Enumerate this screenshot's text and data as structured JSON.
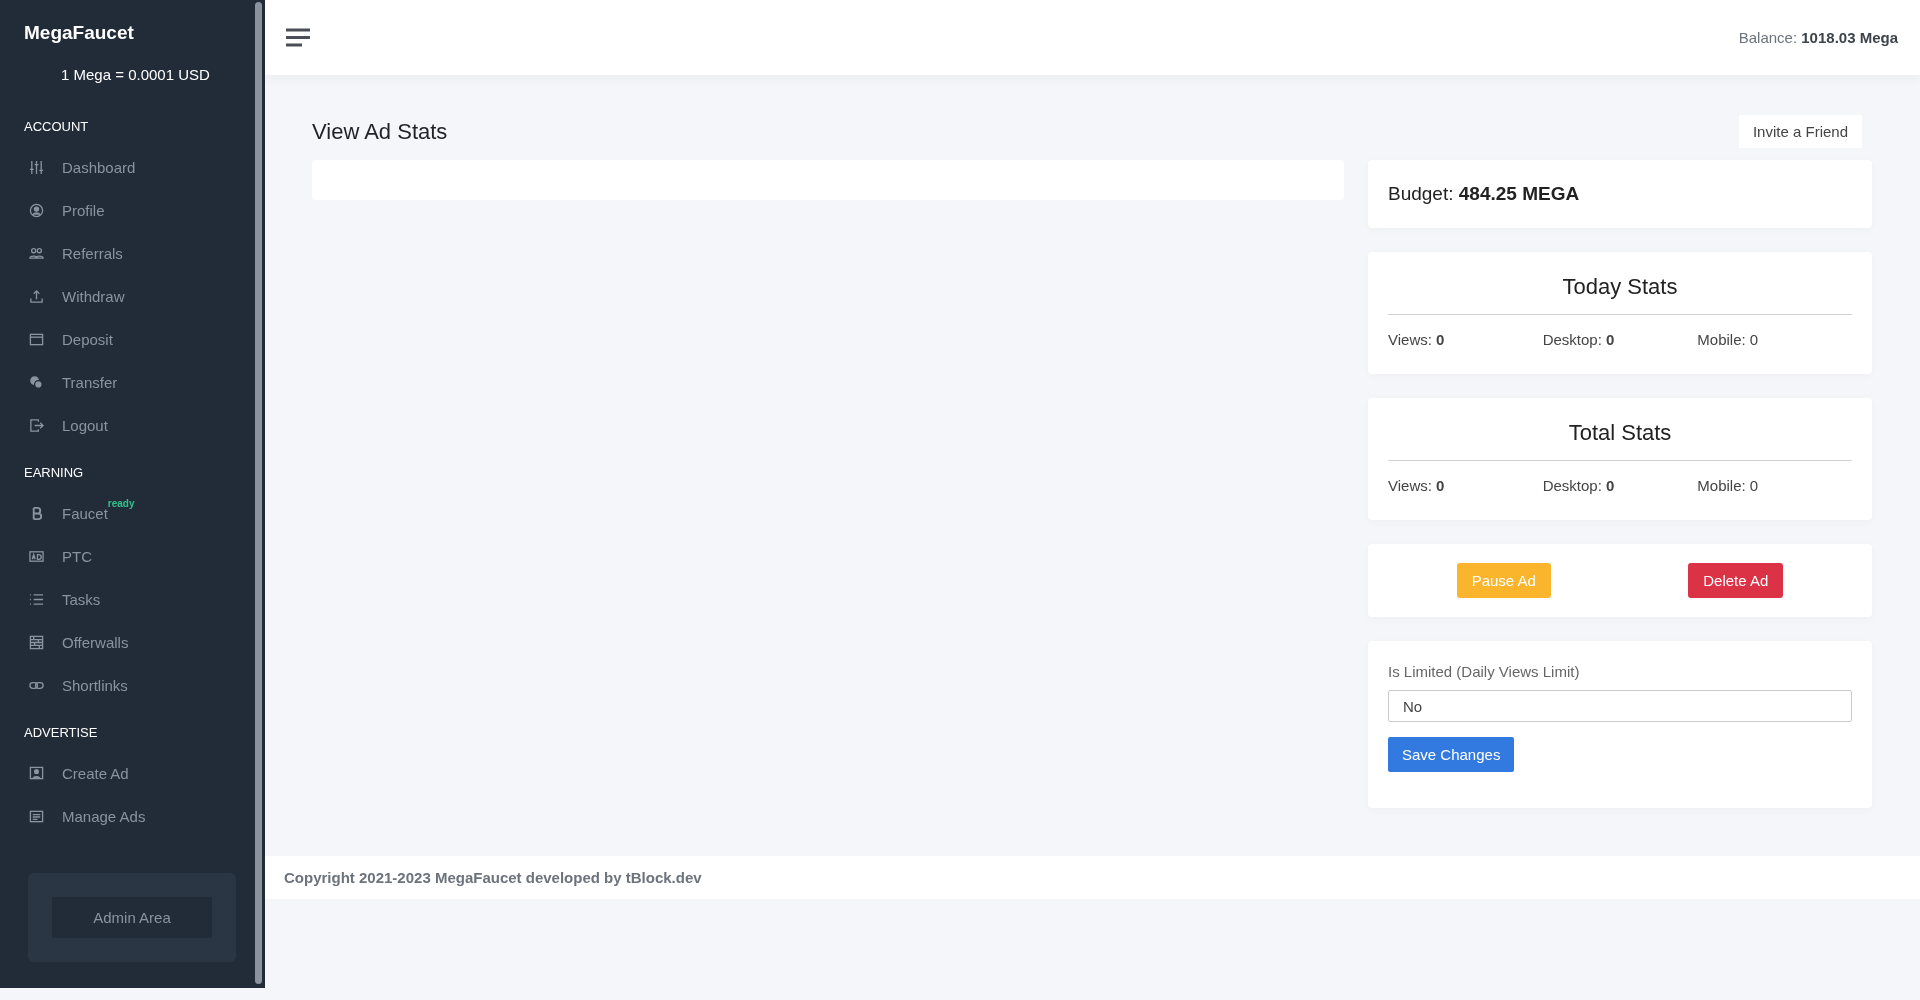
{
  "sidebar": {
    "brand": "MegaFaucet",
    "rate": "1 Mega = 0.0001 USD",
    "sections": [
      {
        "heading": "ACCOUNT",
        "items": [
          {
            "label": "Dashboard"
          },
          {
            "label": "Profile"
          },
          {
            "label": "Referrals"
          },
          {
            "label": "Withdraw"
          },
          {
            "label": "Deposit"
          },
          {
            "label": "Transfer"
          },
          {
            "label": "Logout"
          }
        ]
      },
      {
        "heading": "EARNING",
        "items": [
          {
            "label": "Faucet",
            "badge": "ready"
          },
          {
            "label": "PTC"
          },
          {
            "label": "Tasks"
          },
          {
            "label": "Offerwalls"
          },
          {
            "label": "Shortlinks"
          }
        ]
      },
      {
        "heading": "ADVERTISE",
        "items": [
          {
            "label": "Create Ad"
          },
          {
            "label": "Manage Ads"
          }
        ]
      }
    ],
    "admin_button": "Admin Area"
  },
  "topbar": {
    "balance": "Balance: **1018.03 Mega**"
  },
  "page": {
    "title": "View Ad Stats",
    "invite_button": "Invite a Friend"
  },
  "budget": "Budget: **484.25 MEGA**",
  "stats_cards": [
    {
      "title": "Today Stats",
      "stats": [
        "Views: **0**",
        "Desktop: **0**",
        "Mobile: 0"
      ]
    },
    {
      "title": "Total Stats",
      "stats": [
        "Views: **0**",
        "Desktop: **0**",
        "Mobile: 0"
      ]
    }
  ],
  "actions": [
    {
      "label": "Pause Ad",
      "kind": "warning"
    },
    {
      "label": "Delete Ad",
      "kind": "danger"
    }
  ],
  "form": {
    "label": "Is Limited (Daily Views Limit)",
    "value": "No",
    "submit": "Save Changes"
  },
  "footer": "Copyright 2021-2023 MegaFaucet developed by tBlock.dev"
}
